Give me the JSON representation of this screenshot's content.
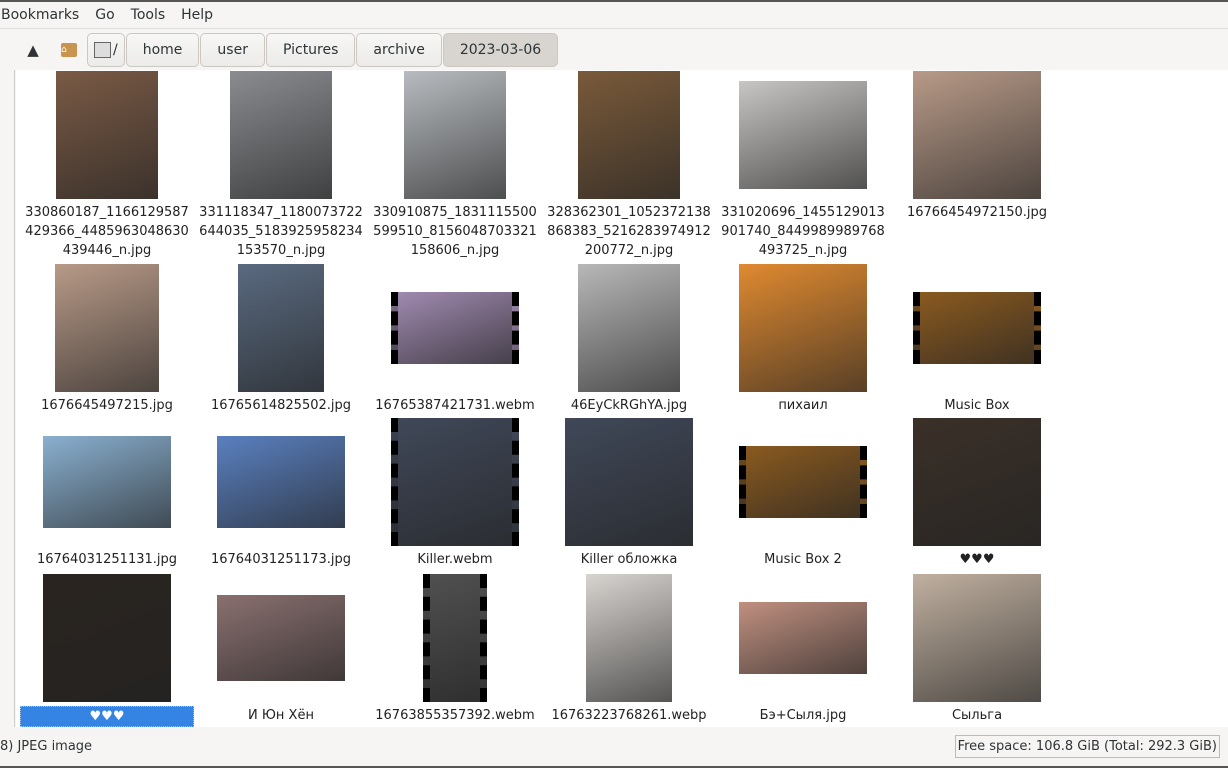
{
  "menu": [
    "Bookmarks",
    "Go",
    "Tools",
    "Help"
  ],
  "toolbar": {
    "up_icon": "arrow-up-icon",
    "home_icon": "home-folder-icon",
    "root_label": "/",
    "root_icon": "drive-icon"
  },
  "breadcrumb": [
    "home",
    "user",
    "Pictures",
    "archive",
    "2023-03-06"
  ],
  "files": [
    {
      "name": "330860187_1166129587429366_4485963048630439446_n.jpg",
      "color": "#7a5a45",
      "video": false
    },
    {
      "name": "331118347_1180073722644035_5183925958234153570_n.jpg",
      "color": "#8a8c90",
      "video": false
    },
    {
      "name": "330910875_1831115500599510_8156048703321158606_n.jpg",
      "color": "#b8bcc0",
      "video": false
    },
    {
      "name": "328362301_1052372138868383_5216283974912200772_n.jpg",
      "color": "#7a5a3a",
      "video": false
    },
    {
      "name": "331020696_1455129013901740_8449989989768493725_n.jpg",
      "color": "#c8c6c4",
      "video": false
    },
    {
      "name": "16766454972150.jpg",
      "color": "#b89a88",
      "video": false
    },
    {
      "name": "1676645497215.jpg",
      "color": "#b89a88",
      "video": false
    },
    {
      "name": "16765614825502.jpg",
      "color": "#5a6a80",
      "video": false
    },
    {
      "name": "16765387421731.webm",
      "color": "#a08ab0",
      "video": true
    },
    {
      "name": "46EyCkRGhYA.jpg",
      "color": "#b8b8b8",
      "video": false
    },
    {
      "name": "пихаил",
      "color": "#e08a30",
      "video": false
    },
    {
      "name": "Music Box",
      "color": "#8a5a20",
      "video": true
    },
    {
      "name": "16764031251131.jpg",
      "color": "#8ab0d0",
      "video": false
    },
    {
      "name": "16764031251173.jpg",
      "color": "#5a80c0",
      "video": false
    },
    {
      "name": "Killer.webm",
      "color": "#404858",
      "video": true
    },
    {
      "name": "Killer обложка",
      "color": "#404858",
      "video": false
    },
    {
      "name": "Music Box 2",
      "color": "#8a5a20",
      "video": true
    },
    {
      "name": "♥♥♥",
      "color": "#3a3028",
      "video": false
    },
    {
      "name": "♥♥♥",
      "color": "#2a2420",
      "video": false,
      "selected": true
    },
    {
      "name": "И Юн Хён",
      "color": "#8a7070",
      "video": false
    },
    {
      "name": "16763855357392.webm",
      "color": "#505050",
      "video": true
    },
    {
      "name": "16763223768261.webp",
      "color": "#d8d4d0",
      "video": false
    },
    {
      "name": "Бэ+Сыля.jpg",
      "color": "#c09080",
      "video": false
    },
    {
      "name": "Сыльга",
      "color": "#c0b0a0",
      "video": false
    }
  ],
  "status": {
    "left": "8) JPEG image",
    "right": "Free space: 106.8 GiB (Total: 292.3 GiB)"
  }
}
